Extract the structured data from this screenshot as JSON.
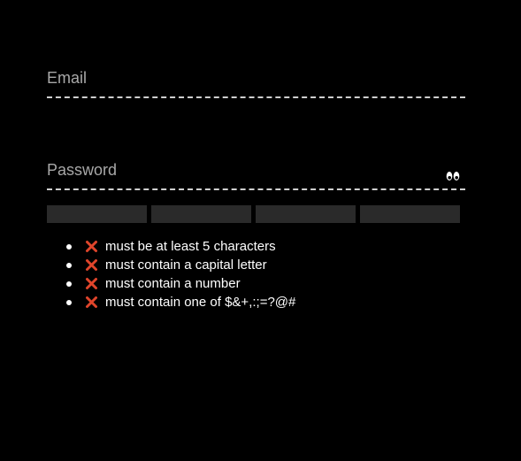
{
  "form": {
    "email": {
      "label": "Email",
      "value": ""
    },
    "password": {
      "label": "Password",
      "value": "",
      "toggle_icon": "eyes-icon"
    }
  },
  "strength_meter": {
    "segments": 4,
    "filled": 0,
    "empty_color": "#2a2a2a"
  },
  "requirements": [
    {
      "text": "must be at least 5 characters",
      "status": "failed",
      "icon": "cross-icon"
    },
    {
      "text": "must contain a capital letter",
      "status": "failed",
      "icon": "cross-icon"
    },
    {
      "text": "must contain a number",
      "status": "failed",
      "icon": "cross-icon"
    },
    {
      "text": "must contain one of $&+,:;=?@#",
      "status": "failed",
      "icon": "cross-icon"
    }
  ],
  "colors": {
    "background": "#000000",
    "label": "#a8a8a8",
    "underline": "#cfcfcf",
    "cross": "#e0452b",
    "text": "#ffffff"
  }
}
